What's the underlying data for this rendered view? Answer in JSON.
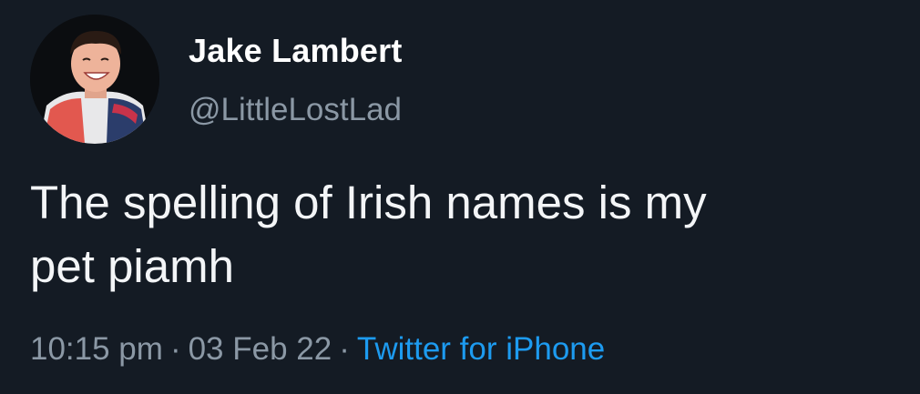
{
  "author": {
    "name": "Jake Lambert",
    "handle": "@LittleLostLad"
  },
  "tweet": {
    "text": "The spelling of Irish names is my\npet piamh"
  },
  "meta": {
    "time": "10:15 pm",
    "date": "03 Feb 22",
    "separator": "·",
    "source": "Twitter for iPhone"
  },
  "colors": {
    "background": "#141b24",
    "secondary_text": "#8b98a5",
    "link": "#1d9bf0"
  }
}
